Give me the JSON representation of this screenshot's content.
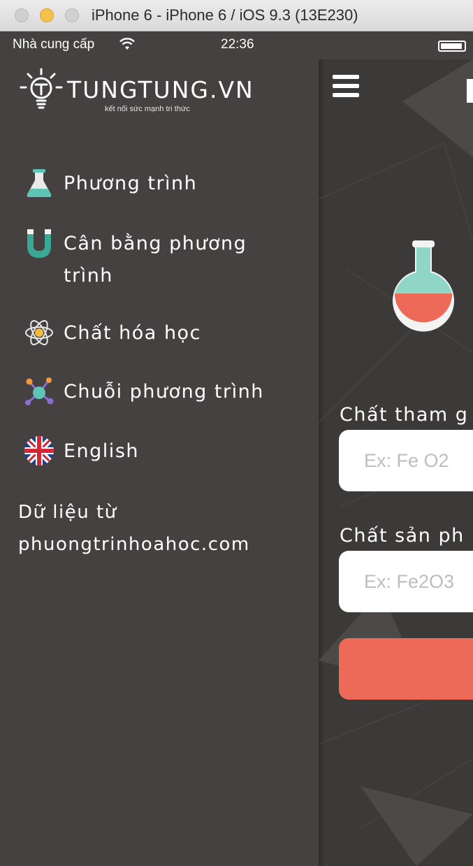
{
  "window": {
    "title": "iPhone 6 - iPhone 6 / iOS 9.3 (13E230)"
  },
  "status_bar": {
    "carrier": "Nhà cung cấp",
    "time": "22:36"
  },
  "drawer": {
    "logo_text": "TUNGTUNG.VN",
    "logo_tagline": "kết nối sức mạnh tri thức",
    "menu": [
      {
        "label": "Phương trình",
        "icon": "flask-icon"
      },
      {
        "label": "Cân bằng phương trình",
        "icon": "magnet-icon"
      },
      {
        "label": "Chất hóa học",
        "icon": "atom-icon"
      },
      {
        "label": "Chuỗi phương trình",
        "icon": "molecule-icon"
      },
      {
        "label": "English",
        "icon": "uk-flag-icon"
      }
    ],
    "credit": "Dữ liệu từ phuongtrinhoahoc.com"
  },
  "main": {
    "reactants_label": "Chất tham g",
    "reactants_placeholder": "Ex: Fe O2",
    "products_label": "Chất sản ph",
    "products_placeholder": "Ex: Fe2O3"
  },
  "colors": {
    "accent": "#ec6a57",
    "teal": "#5ec4b6",
    "background": "#454141"
  }
}
